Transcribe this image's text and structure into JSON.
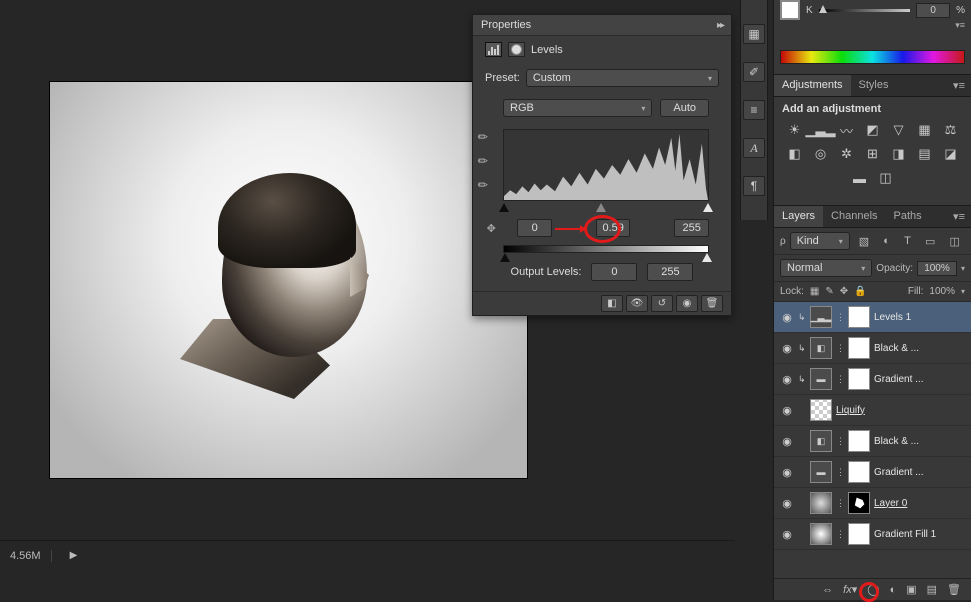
{
  "status": {
    "zoom": "4.56M",
    "play_icon": "▶"
  },
  "properties": {
    "title": "Properties",
    "adjustment_label": "Levels",
    "preset_label": "Preset:",
    "preset_value": "Custom",
    "channel_value": "RGB",
    "auto_label": "Auto",
    "input_black": "0",
    "input_gamma": "0.59",
    "input_white": "255",
    "output_label": "Output Levels:",
    "output_black": "0",
    "output_white": "255"
  },
  "color": {
    "channel": "K",
    "value": "0",
    "unit": "%"
  },
  "adjustments": {
    "tab_adjustments": "Adjustments",
    "tab_styles": "Styles",
    "heading": "Add an adjustment"
  },
  "layers": {
    "tab_layers": "Layers",
    "tab_channels": "Channels",
    "tab_paths": "Paths",
    "filter_label": "Kind",
    "blend_mode": "Normal",
    "opacity_label": "Opacity:",
    "opacity_value": "100%",
    "lock_label": "Lock:",
    "fill_label": "Fill:",
    "fill_value": "100%",
    "items": [
      {
        "name": "Levels 1"
      },
      {
        "name": "Black & ..."
      },
      {
        "name": "Gradient ..."
      },
      {
        "name": "Liquify"
      },
      {
        "name": "Black & ..."
      },
      {
        "name": "Gradient ..."
      },
      {
        "name": "Layer 0"
      },
      {
        "name": "Gradient Fill 1"
      }
    ]
  }
}
